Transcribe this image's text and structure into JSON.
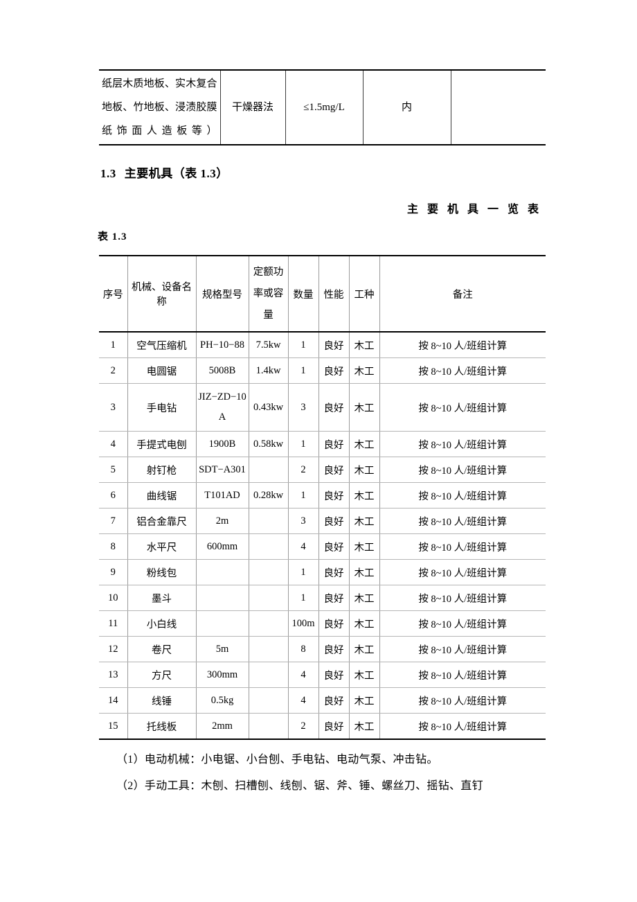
{
  "top_table": {
    "rows": [
      {
        "material": "纸层木质地板、实木复合地板、竹地板、浸渍胶膜纸饰面人造板等）",
        "method": "干燥器法",
        "limit": "≤1.5mg/L",
        "usage": "内",
        "remark": ""
      }
    ]
  },
  "section": {
    "number": "1.3",
    "title": "主要机具（表 1.3）"
  },
  "table_title": "主要机具一览表",
  "table_label": "表 1.3",
  "main_table": {
    "headers": [
      "序号",
      "机械、设备名称",
      "规格型号",
      "定额功率或容量",
      "数量",
      "性能",
      "工种",
      "备注"
    ],
    "header_parts": {
      "power": [
        "定额功",
        "率或容",
        "量"
      ]
    },
    "rows": [
      {
        "no": "1",
        "name": "空气压缩机",
        "model": "PH−10−88",
        "power": "7.5kw",
        "qty": "1",
        "condition": "良好",
        "trade": "木工",
        "remark": "按 8~10 人/班组计算"
      },
      {
        "no": "2",
        "name": "电圆锯",
        "model": "5008B",
        "power": "1.4kw",
        "qty": "1",
        "condition": "良好",
        "trade": "木工",
        "remark": "按 8~10 人/班组计算"
      },
      {
        "no": "3",
        "name": "手电钻",
        "model": "JIZ−ZD−10 A",
        "power": "0.43kw",
        "qty": "3",
        "condition": "良好",
        "trade": "木工",
        "remark": "按 8~10 人/班组计算"
      },
      {
        "no": "4",
        "name": "手提式电刨",
        "model": "1900B",
        "power": "0.58kw",
        "qty": "1",
        "condition": "良好",
        "trade": "木工",
        "remark": "按 8~10 人/班组计算"
      },
      {
        "no": "5",
        "name": "射钉枪",
        "model": "SDT−A301",
        "power": "",
        "qty": "2",
        "condition": "良好",
        "trade": "木工",
        "remark": "按 8~10 人/班组计算"
      },
      {
        "no": "6",
        "name": "曲线锯",
        "model": "T101AD",
        "power": "0.28kw",
        "qty": "1",
        "condition": "良好",
        "trade": "木工",
        "remark": "按 8~10 人/班组计算"
      },
      {
        "no": "7",
        "name": "铝合金靠尺",
        "model": "2m",
        "power": "",
        "qty": "3",
        "condition": "良好",
        "trade": "木工",
        "remark": "按 8~10 人/班组计算"
      },
      {
        "no": "8",
        "name": "水平尺",
        "model": "600mm",
        "power": "",
        "qty": "4",
        "condition": "良好",
        "trade": "木工",
        "remark": "按 8~10 人/班组计算"
      },
      {
        "no": "9",
        "name": "粉线包",
        "model": "",
        "power": "",
        "qty": "1",
        "condition": "良好",
        "trade": "木工",
        "remark": "按 8~10 人/班组计算"
      },
      {
        "no": "10",
        "name": "墨斗",
        "model": "",
        "power": "",
        "qty": "1",
        "condition": "良好",
        "trade": "木工",
        "remark": "按 8~10 人/班组计算"
      },
      {
        "no": "11",
        "name": "小白线",
        "model": "",
        "power": "",
        "qty": "100m",
        "condition": "良好",
        "trade": "木工",
        "remark": "按 8~10 人/班组计算"
      },
      {
        "no": "12",
        "name": "卷尺",
        "model": "5m",
        "power": "",
        "qty": "8",
        "condition": "良好",
        "trade": "木工",
        "remark": "按 8~10 人/班组计算"
      },
      {
        "no": "13",
        "name": "方尺",
        "model": "300mm",
        "power": "",
        "qty": "4",
        "condition": "良好",
        "trade": "木工",
        "remark": "按 8~10 人/班组计算"
      },
      {
        "no": "14",
        "name": "线锤",
        "model": "0.5kg",
        "power": "",
        "qty": "4",
        "condition": "良好",
        "trade": "木工",
        "remark": "按 8~10 人/班组计算"
      },
      {
        "no": "15",
        "name": "托线板",
        "model": "2mm",
        "power": "",
        "qty": "2",
        "condition": "良好",
        "trade": "木工",
        "remark": "按 8~10 人/班组计算"
      }
    ]
  },
  "notes": [
    "（1）电动机械：小电锯、小台刨、手电钻、电动气泵、冲击钻。",
    "（2）手动工具：木刨、扫槽刨、线刨、锯、斧、锤、螺丝刀、摇钻、直钉"
  ]
}
